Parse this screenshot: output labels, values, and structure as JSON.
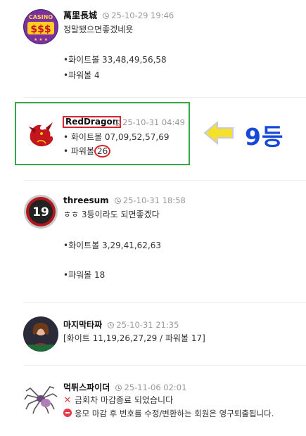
{
  "posts": [
    {
      "author": "萬里長城",
      "time": "25-10-29 19:46",
      "lines": [
        "정말됐으면좋겠네욧",
        "•화이트볼 33,48,49,56,58",
        "•파워볼 4"
      ],
      "avatar_text": "CASINO"
    },
    {
      "author": "RedDragon",
      "time": "25-10-31 04:49",
      "white": "• 화이트볼 07,09,52,57,69",
      "power_prefix": "• 파워볼",
      "power_value": "26"
    },
    {
      "author": "threesum",
      "time": "25-10-31 18:58",
      "lines": [
        "ㅎㅎ 3등이라도 되면좋겠다",
        "•화이트볼 3,29,41,62,63",
        "•파워볼 18"
      ],
      "avatar_text": "19"
    },
    {
      "author": "마지막타짜",
      "time": "25-10-31 21:35",
      "lines": [
        "[화이트 11,19,26,27,29 / 파워볼 17]"
      ]
    },
    {
      "author": "먹튀스파이더",
      "time": "25-11-06 02:01",
      "lines": [
        "금회차 마감종료 되었습니다",
        "응모 마감 후 번호를 수정/변환하는 회원은 영구퇴출됩니다."
      ]
    }
  ],
  "annotation": {
    "rank_label": "9등"
  },
  "colors": {
    "highlight_green": "#37a84a",
    "highlight_red": "#d8242c",
    "rank_blue": "#1749d8",
    "arrow_yellow": "#f5e12a"
  }
}
